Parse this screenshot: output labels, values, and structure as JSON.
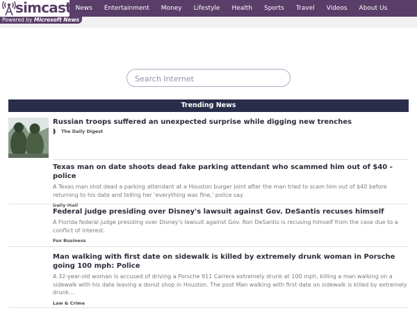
{
  "header": {
    "logo_text": "simcast",
    "powered_prefix": "Powered by ",
    "powered_brand": "Microsoft News",
    "nav": [
      "News",
      "Entertainment",
      "Money",
      "Lifestyle",
      "Health",
      "Sports",
      "Travel",
      "Videos",
      "About Us"
    ],
    "brand_color": "#5a3d68"
  },
  "search": {
    "placeholder": "Search Internet"
  },
  "trending": {
    "title": "Trending News",
    "articles": [
      {
        "title": "Russian troops suffered an unexpected surprise while digging new trenches",
        "description": "",
        "source": "The Daily Digest",
        "has_thumbnail": true,
        "source_icon": "audio-wave-icon"
      },
      {
        "title": "Texas man on date shoots dead fake parking attendant who scammed him out of $40 - police",
        "description": "A Texas man shot dead a parking attendant at a Houston burger joint after the man tried to scam him out of $40 before returning to his date and telling her 'everything was fine,' police say",
        "source": "Daily Mail"
      },
      {
        "title": "Federal judge presiding over Disney's lawsuit against Gov. DeSantis recuses himself",
        "description": "A Florida federal judge presiding over Disney's lawsuit against Gov. Ron DeSantis is recusing himself from the case due to a conflict of interest.",
        "source": "Fox Business"
      },
      {
        "title": "Man walking with first date on sidewalk is killed by extremely drunk woman in Porsche going 100 mph: Police",
        "description": "A 32-year-old woman is accused of driving a Porsche 911 Carrera extremely drunk at 100 mph, killing a man walking on a sidewalk with his date leaving a donut shop in Houston. The post Man walking with first date on sidewalk is killed by extremely drunk…",
        "source": "Law & Crime"
      }
    ]
  }
}
